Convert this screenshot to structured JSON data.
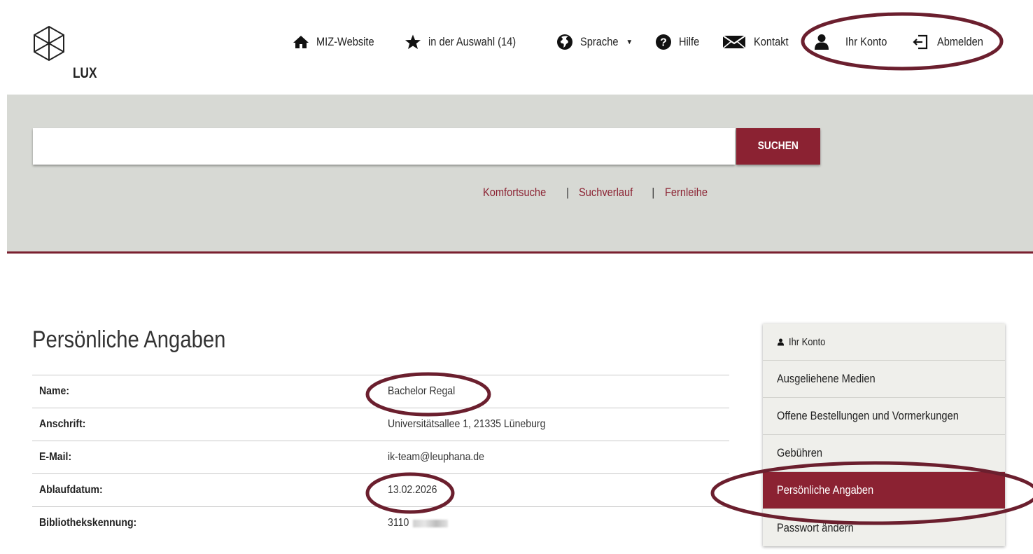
{
  "colors": {
    "accent": "#8b2232",
    "band": "#d7d9d4",
    "annotation": "#6b1f2e"
  },
  "logo": {
    "text": "LUX"
  },
  "nav": {
    "items": [
      {
        "icon": "home-icon",
        "label": "MIZ-Website"
      },
      {
        "icon": "star-icon",
        "label": "in der Auswahl (14)"
      },
      {
        "icon": "globe-icon",
        "label": "Sprache"
      },
      {
        "icon": "help-icon",
        "label": "Hilfe"
      },
      {
        "icon": "envelope-icon",
        "label": "Kontakt"
      },
      {
        "icon": "user-icon",
        "label": "Ihr Konto"
      },
      {
        "icon": "logout-icon",
        "label": "Abmelden"
      }
    ]
  },
  "search": {
    "value": "",
    "placeholder": "",
    "button": "SUCHEN"
  },
  "sublinks": {
    "comfort": "Komfortsuche",
    "sep": "|",
    "history": "Suchverlauf",
    "ill": "Fernleihe"
  },
  "page": {
    "title": "Persönliche Angaben",
    "rows": [
      {
        "key": "Name:",
        "value": "Bachelor Regal"
      },
      {
        "key": "Anschrift:",
        "value": "Universitätsallee 1, 21335 Lüneburg"
      },
      {
        "key": "E-Mail:",
        "value": "ik-team@leuphana.de"
      },
      {
        "key": "Ablaufdatum:",
        "value": "13.02.2026"
      },
      {
        "key": "Bibliothekskennung:",
        "value": "3110"
      }
    ]
  },
  "sidebar": {
    "header": "Ihr Konto",
    "items": [
      {
        "label": "Ausgeliehene Medien"
      },
      {
        "label": "Offene Bestellungen und Vormerkungen"
      },
      {
        "label": "Gebühren"
      },
      {
        "label": "Persönliche Angaben",
        "active": true
      },
      {
        "label": "Passwort ändern"
      }
    ]
  }
}
